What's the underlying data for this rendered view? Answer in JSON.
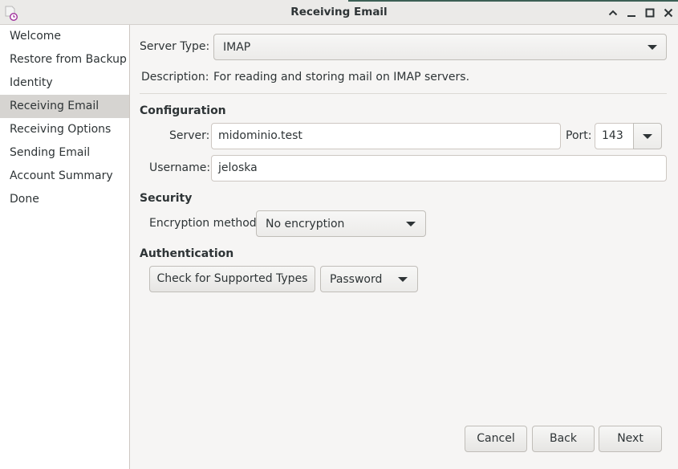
{
  "window": {
    "title": "Receiving Email"
  },
  "sidebar": {
    "items": [
      {
        "label": "Welcome"
      },
      {
        "label": "Restore from Backup"
      },
      {
        "label": "Identity"
      },
      {
        "label": "Receiving Email",
        "active": true
      },
      {
        "label": "Receiving Options"
      },
      {
        "label": "Sending Email"
      },
      {
        "label": "Account Summary"
      },
      {
        "label": "Done"
      }
    ]
  },
  "form": {
    "server_type_label": "Server Type:",
    "server_type_value": "IMAP",
    "description_label": "Description:",
    "description_value": "For reading and storing mail on IMAP servers.",
    "configuration_header": "Configuration",
    "server_label": "Server:",
    "server_value": "midominio.test",
    "port_label": "Port:",
    "port_value": "143",
    "username_label": "Username:",
    "username_value": "jeloska",
    "security_header": "Security",
    "encryption_label": "Encryption method:",
    "encryption_value": "No encryption",
    "authentication_header": "Authentication",
    "check_types_label": "Check for Supported Types",
    "auth_method_value": "Password"
  },
  "footer": {
    "cancel_label": "Cancel",
    "back_label": "Back",
    "next_label": "Next"
  },
  "colors": {
    "sidebar_selected": "#d6d4d1",
    "title_accent": "#3c5f55",
    "app_icon_accent": "#a0309b"
  },
  "icons": {
    "app": "app-clock-icon",
    "minimize": "minimize-icon",
    "maximize": "maximize-icon",
    "restore": "chevron-up-icon",
    "close": "close-icon"
  }
}
